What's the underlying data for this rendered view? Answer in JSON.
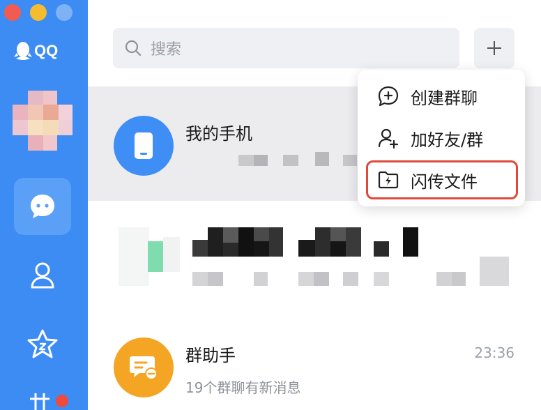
{
  "window": {
    "traffic_lights": [
      "close",
      "minimize",
      "zoom"
    ]
  },
  "sidebar": {
    "logo_text": "QQ",
    "nav": [
      {
        "name": "messages",
        "icon": "chat-bubble-icon",
        "active": true
      },
      {
        "name": "contacts",
        "icon": "person-icon",
        "active": false
      },
      {
        "name": "favorites",
        "icon": "star-icon",
        "active": false
      },
      {
        "name": "more",
        "icon": "grid-icon",
        "active": false,
        "badge": true
      }
    ]
  },
  "search": {
    "placeholder": "搜索"
  },
  "chats": [
    {
      "name": "我的手机",
      "icon": "phone-icon",
      "selected": true
    },
    {
      "name": "",
      "blurred": true
    },
    {
      "name": "群助手",
      "time": "23:36",
      "preview": "19个群聊有新消息",
      "icon": "group-assistant-icon"
    }
  ],
  "menu": {
    "items": [
      {
        "label": "创建群聊",
        "icon": "create-group-icon"
      },
      {
        "label": "加好友/群",
        "icon": "add-friend-icon"
      },
      {
        "label": "闪传文件",
        "icon": "flash-transfer-icon",
        "highlighted": true
      }
    ]
  },
  "colors": {
    "sidebar": "#3d8cf4",
    "accent": "#3f8ef6",
    "highlight_border": "#e0483a",
    "assistant": "#f5a524"
  }
}
